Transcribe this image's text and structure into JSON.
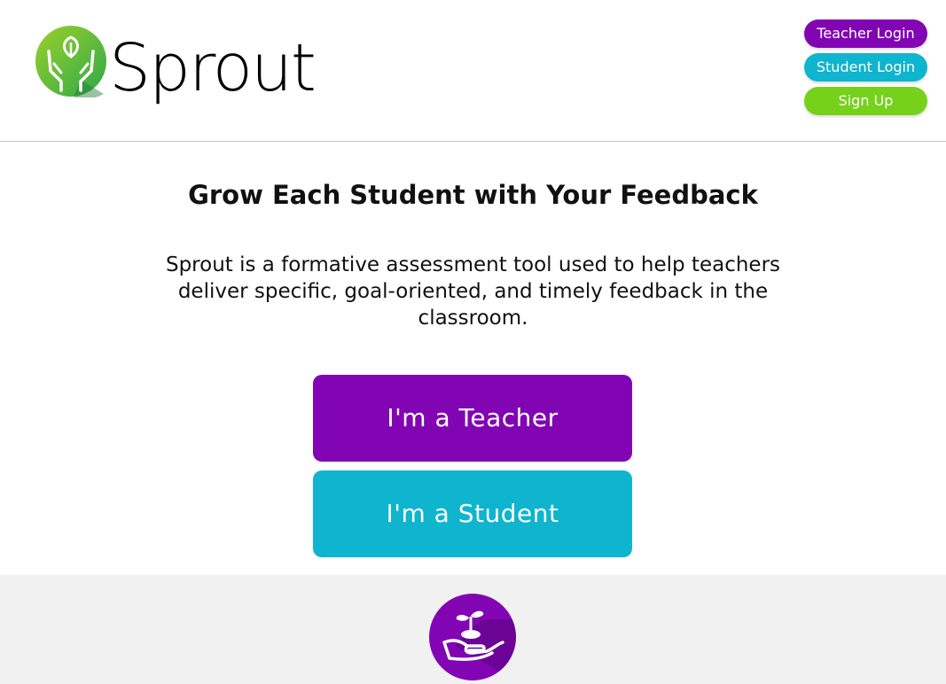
{
  "header": {
    "logo_text": "Sprout",
    "nav": {
      "teacher_login": "Teacher Login",
      "student_login": "Student Login",
      "sign_up": "Sign Up"
    }
  },
  "main": {
    "headline": "Grow Each Student with Your Feedback",
    "description": "Sprout is a formative assessment tool used to help teachers deliver specific, goal-oriented, and timely feedback in the classroom.",
    "teacher_button": "I'm a Teacher",
    "student_button": "I'm a Student"
  },
  "icons": {
    "logo": "hands-leaf-icon",
    "footer": "hand-sprout-icon"
  },
  "colors": {
    "purple": "#8205b4",
    "teal": "#0fb4ce",
    "green": "#76d11b"
  }
}
